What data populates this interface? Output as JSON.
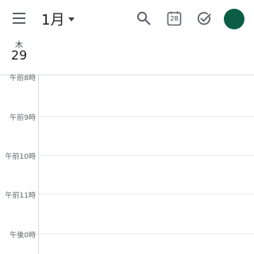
{
  "header": {
    "month_label": "1月",
    "today_icon_day": "28"
  },
  "day": {
    "weekday": "木",
    "number": "29"
  },
  "hours": [
    "午前8時",
    "午前9時",
    "午前10時",
    "午前11時",
    "午後0時"
  ],
  "colors": {
    "avatar": "#0b5d45",
    "gridline": "#e8eaed",
    "divider": "#dadce0"
  },
  "icons": [
    "menu-icon",
    "dropdown-caret-icon",
    "search-icon",
    "today-calendar-icon",
    "tasks-icon"
  ]
}
